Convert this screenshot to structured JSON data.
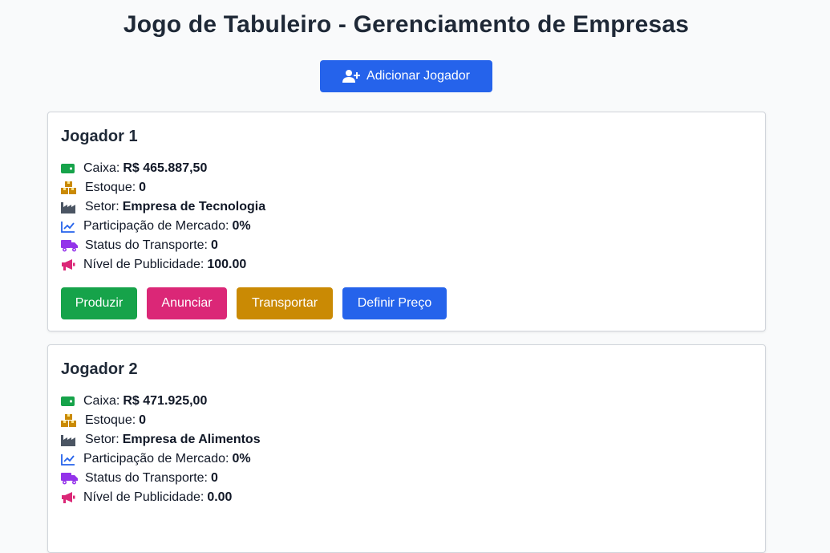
{
  "header": {
    "title": "Jogo de Tabuleiro - Gerenciamento de Empresas",
    "add_player_label": "Adicionar Jogador",
    "add_player_icon": "user-plus-icon"
  },
  "labels": {
    "cash": "Caixa:",
    "stock": "Estoque:",
    "sector": "Setor:",
    "market_share": "Participação de Mercado:",
    "transport": "Status do Transporte:",
    "advertising": "Nível de Publicidade:"
  },
  "actions": {
    "produce": "Produzir",
    "advertise": "Anunciar",
    "transport": "Transportar",
    "set_price": "Definir Preço"
  },
  "colors": {
    "primary": "#2563eb",
    "cash_icon": "#16a34a",
    "stock_icon": "#ca8a04",
    "sector_icon": "#4b5563",
    "market_icon": "#2563eb",
    "transport_icon": "#9333ea",
    "advertising_icon": "#db2777",
    "produce": "#16a34a",
    "advertise": "#db2777",
    "transport_btn": "#ca8a04",
    "set_price": "#2563eb"
  },
  "players": [
    {
      "name": "Jogador 1",
      "cash": "R$ 465.887,50",
      "stock": "0",
      "sector": "Empresa de Tecnologia",
      "market_share": "0%",
      "transport": "0",
      "advertising": "100.00"
    },
    {
      "name": "Jogador 2",
      "cash": "R$ 471.925,00",
      "stock": "0",
      "sector": "Empresa de Alimentos",
      "market_share": "0%",
      "transport": "0",
      "advertising": "0.00"
    }
  ]
}
